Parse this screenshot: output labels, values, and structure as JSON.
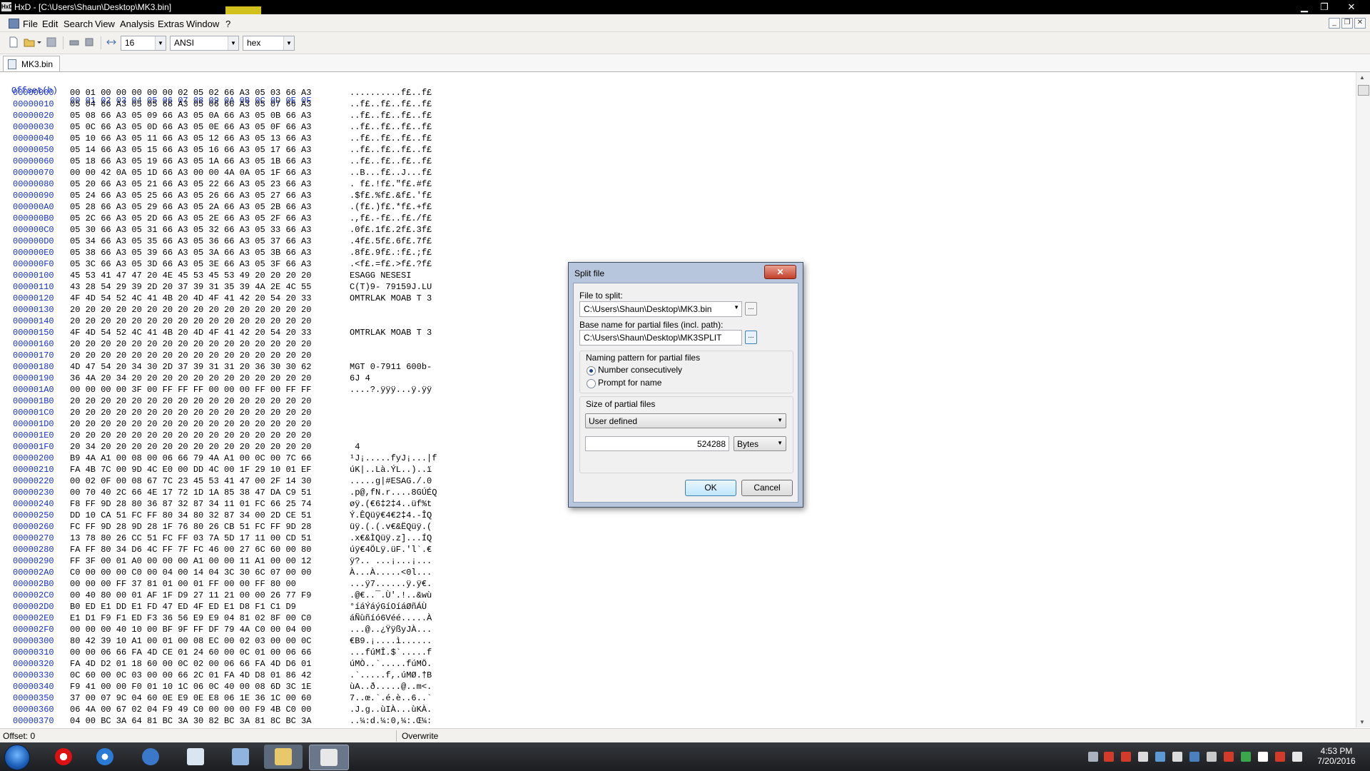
{
  "window": {
    "title": "HxD - [C:\\Users\\Shaun\\Desktop\\MK3.bin]",
    "minimize": "▁",
    "maximize": "❐",
    "close": "✕"
  },
  "menu": {
    "items": [
      "File",
      "Edit",
      "Search",
      "View",
      "Analysis",
      "Extras",
      "Window",
      "?"
    ]
  },
  "toolbar": {
    "bytes_per_row": "16",
    "charset": "ANSI",
    "offset_base": "hex"
  },
  "tab": {
    "label": "MK3.bin"
  },
  "hexview": {
    "header_offset": "Offset(h)",
    "header_columns": "00 01 02 03 04 05 06 07 08 09 0A 0B 0C 0D 0E 0F",
    "rows": [
      {
        "off": "00000000",
        "hex": "00 01 00 00 00 00 00 02 05 02 66 A3 05 03 66 A3",
        "asc": "..........f£..f£"
      },
      {
        "off": "00000010",
        "hex": "05 04 66 A3 05 05 66 A3 05 06 66 A3 05 07 66 A3",
        "asc": "..f£..f£..f£..f£"
      },
      {
        "off": "00000020",
        "hex": "05 08 66 A3 05 09 66 A3 05 0A 66 A3 05 0B 66 A3",
        "asc": "..f£..f£..f£..f£"
      },
      {
        "off": "00000030",
        "hex": "05 0C 66 A3 05 0D 66 A3 05 0E 66 A3 05 0F 66 A3",
        "asc": "..f£..f£..f£..f£"
      },
      {
        "off": "00000040",
        "hex": "05 10 66 A3 05 11 66 A3 05 12 66 A3 05 13 66 A3",
        "asc": "..f£..f£..f£..f£"
      },
      {
        "off": "00000050",
        "hex": "05 14 66 A3 05 15 66 A3 05 16 66 A3 05 17 66 A3",
        "asc": "..f£..f£..f£..f£"
      },
      {
        "off": "00000060",
        "hex": "05 18 66 A3 05 19 66 A3 05 1A 66 A3 05 1B 66 A3",
        "asc": "..f£..f£..f£..f£"
      },
      {
        "off": "00000070",
        "hex": "00 00 42 0A 05 1D 66 A3 00 00 4A 0A 05 1F 66 A3",
        "asc": "..B...f£..J...f£"
      },
      {
        "off": "00000080",
        "hex": "05 20 66 A3 05 21 66 A3 05 22 66 A3 05 23 66 A3",
        "asc": ". f£.!f£.\"f£.#f£"
      },
      {
        "off": "00000090",
        "hex": "05 24 66 A3 05 25 66 A3 05 26 66 A3 05 27 66 A3",
        "asc": ".$f£.%f£.&f£.'f£"
      },
      {
        "off": "000000A0",
        "hex": "05 28 66 A3 05 29 66 A3 05 2A 66 A3 05 2B 66 A3",
        "asc": ".(f£.)f£.*f£.+f£"
      },
      {
        "off": "000000B0",
        "hex": "05 2C 66 A3 05 2D 66 A3 05 2E 66 A3 05 2F 66 A3",
        "asc": ".,f£.-f£..f£./f£"
      },
      {
        "off": "000000C0",
        "hex": "05 30 66 A3 05 31 66 A3 05 32 66 A3 05 33 66 A3",
        "asc": ".0f£.1f£.2f£.3f£"
      },
      {
        "off": "000000D0",
        "hex": "05 34 66 A3 05 35 66 A3 05 36 66 A3 05 37 66 A3",
        "asc": ".4f£.5f£.6f£.7f£"
      },
      {
        "off": "000000E0",
        "hex": "05 38 66 A3 05 39 66 A3 05 3A 66 A3 05 3B 66 A3",
        "asc": ".8f£.9f£.:f£.;f£"
      },
      {
        "off": "000000F0",
        "hex": "05 3C 66 A3 05 3D 66 A3 05 3E 66 A3 05 3F 66 A3",
        "asc": ".<f£.=f£.>f£.?f£"
      },
      {
        "off": "00000100",
        "hex": "45 53 41 47 47 20 4E 45 53 45 53 49 20 20 20 20",
        "asc": "ESAGG NESESI    "
      },
      {
        "off": "00000110",
        "hex": "43 28 54 29 39 2D 20 37 39 31 35 39 4A 2E 4C 55",
        "asc": "C(T)9- 79159J.LU"
      },
      {
        "off": "00000120",
        "hex": "4F 4D 54 52 4C 41 4B 20 4D 4F 41 42 20 54 20 33",
        "asc": "OMTRLAK MOAB T 3"
      },
      {
        "off": "00000130",
        "hex": "20 20 20 20 20 20 20 20 20 20 20 20 20 20 20 20",
        "asc": ""
      },
      {
        "off": "00000140",
        "hex": "20 20 20 20 20 20 20 20 20 20 20 20 20 20 20 20",
        "asc": ""
      },
      {
        "off": "00000150",
        "hex": "4F 4D 54 52 4C 41 4B 20 4D 4F 41 42 20 54 20 33",
        "asc": "OMTRLAK MOAB T 3"
      },
      {
        "off": "00000160",
        "hex": "20 20 20 20 20 20 20 20 20 20 20 20 20 20 20 20",
        "asc": ""
      },
      {
        "off": "00000170",
        "hex": "20 20 20 20 20 20 20 20 20 20 20 20 20 20 20 20",
        "asc": ""
      },
      {
        "off": "00000180",
        "hex": "4D 47 54 20 34 30 2D 37 39 31 31 20 36 30 30 62",
        "asc": "MGT 0-7911 600b-"
      },
      {
        "off": "00000190",
        "hex": "36 4A 20 34 20 20 20 20 20 20 20 20 20 20 20 20",
        "asc": "6J 4"
      },
      {
        "off": "000001A0",
        "hex": "00 00 00 00 3F 00 FF FF FF 00 00 00 FF 00 FF FF",
        "asc": "....?.ÿÿÿ...ÿ.ÿÿ"
      },
      {
        "off": "000001B0",
        "hex": "20 20 20 20 20 20 20 20 20 20 20 20 20 20 20 20",
        "asc": ""
      },
      {
        "off": "000001C0",
        "hex": "20 20 20 20 20 20 20 20 20 20 20 20 20 20 20 20",
        "asc": ""
      },
      {
        "off": "000001D0",
        "hex": "20 20 20 20 20 20 20 20 20 20 20 20 20 20 20 20",
        "asc": ""
      },
      {
        "off": "000001E0",
        "hex": "20 20 20 20 20 20 20 20 20 20 20 20 20 20 20 20",
        "asc": ""
      },
      {
        "off": "000001F0",
        "hex": "20 34 20 20 20 20 20 20 20 20 20 20 20 20 20 20",
        "asc": " 4"
      },
      {
        "off": "00000200",
        "hex": "B9 4A A1 00 08 00 06 66 79 4A A1 00 0C 00 7C 66",
        "asc": "¹J¡.....fyJ¡...|f"
      },
      {
        "off": "00000210",
        "hex": "FA 4B 7C 00 9D 4C E0 00 DD 4C 00 1F 29 10 01 EF",
        "asc": "úK|..Là.ÝL..)..ï"
      },
      {
        "off": "00000220",
        "hex": "00 02 0F 00 08 67 7C 23 45 53 41 47 00 2F 14 30",
        "asc": ".....g|#ESAG./.0"
      },
      {
        "off": "00000230",
        "hex": "00 70 40 2C 66 4E 17 72 1D 1A 85 38 47 DA C9 51",
        "asc": ".p@,fN.r....8GÚÉQ"
      },
      {
        "off": "00000240",
        "hex": "F8 FF 9D 28 80 36 87 32 87 34 11 01 FC 66 25 74",
        "asc": "øÿ.(€6‡2‡4..üf%t"
      },
      {
        "off": "00000250",
        "hex": "DD 10 CA 51 FC FF 80 34 80 32 87 34 00 2D CE 51",
        "asc": "Ý.ÊQüÿ€4€2‡4.-ÎQ"
      },
      {
        "off": "00000260",
        "hex": "FC FF 9D 28 9D 28 1F 76 80 26 CB 51 FC FF 9D 28",
        "asc": "üÿ.(.(.v€&ËQüÿ.("
      },
      {
        "off": "00000270",
        "hex": "13 78 80 26 CC 51 FC FF 03 7A 5D 17 11 00 CD 51",
        "asc": ".x€&ÌQüÿ.z]...ÍQ"
      },
      {
        "off": "00000280",
        "hex": "FA FF 80 34 D6 4C FF 7F FC 46 00 27 6C 60 00 80",
        "asc": "úÿ€4ÖLÿ.üF.'l`.€"
      },
      {
        "off": "00000290",
        "hex": "FF 3F 00 01 A0 00 00 00 A1 00 00 11 A1 00 00 12",
        "asc": "ÿ?.. ...¡...¡..."
      },
      {
        "off": "000002A0",
        "hex": "C0 00 00 00 C0 00 04 00 14 04 3C 30 6C 07 00 00",
        "asc": "À...À.....<0l..."
      },
      {
        "off": "000002B0",
        "hex": "00 00 00 FF 37 81 01 00 01 FF 00 00 FF 80 00",
        "asc": "...ÿ7......ÿ.ÿ€."
      },
      {
        "off": "000002C0",
        "hex": "00 40 80 00 01 AF 1F D9 27 11 21 00 00 26 77 F9",
        "asc": ".@€..¯.Ù'.!..&wù"
      },
      {
        "off": "000002D0",
        "hex": "B0 ED E1 DD E1 FD 47 ED 4F ED E1 D8 F1 C1 D9",
        "asc": "°íáÝáýGíOíáØñÁÙ"
      },
      {
        "off": "000002E0",
        "hex": "E1 D1 F9 F1 ED F3 36 56 E9 E9 04 81 02 8F 00 C0",
        "asc": "áÑùñíó6Véé.....À"
      },
      {
        "off": "000002F0",
        "hex": "00 00 00 40 10 00 BF 9F FF DF 79 4A C0 00 04 00",
        "asc": "...@..¿ŸÿßyJÀ..."
      },
      {
        "off": "00000300",
        "hex": "80 42 39 10 A1 00 01 00 08 EC 00 02 03 00 00 0C",
        "asc": "€B9.¡....ì......"
      },
      {
        "off": "00000310",
        "hex": "00 00 06 66 FA 4D CE 01 24 60 00 0C 01 00 06 66",
        "asc": "...fúMÎ.$`.....f"
      },
      {
        "off": "00000320",
        "hex": "FA 4D D2 01 18 60 00 0C 02 00 06 66 FA 4D D6 01",
        "asc": "úMÒ..`.....fúMÖ."
      },
      {
        "off": "00000330",
        "hex": "0C 60 00 0C 03 00 00 66 2C 01 FA 4D D8 01 86 42",
        "asc": ".`.....f,.úMØ.†B"
      },
      {
        "off": "00000340",
        "hex": "F9 41 00 00 F0 01 10 1C 06 0C 40 00 08 6D 3C 1E",
        "asc": "ùA..ð.....@..m<."
      },
      {
        "off": "00000350",
        "hex": "37 00 07 9C 04 60 0E E9 0E E8 06 1E 36 1C 00 60",
        "asc": "7..œ.`.é.è..6..`"
      },
      {
        "off": "00000360",
        "hex": "06 4A 00 67 02 04 F9 49 C0 00 00 00 F9 4B C0 00",
        "asc": ".J.g..ùIÀ...ùKÀ."
      },
      {
        "off": "00000370",
        "hex": "04 00 BC 3A 64 81 BC 3A 30 82 BC 3A 81 8C BC 3A",
        "asc": "..¼:d.¼:0‚¼:.Œ¼:"
      }
    ]
  },
  "statusbar": {
    "offset": "Offset: 0",
    "mode": "Overwrite"
  },
  "dialog": {
    "title": "Split file",
    "close_label": "✕",
    "file_to_split_label": "File to split:",
    "file_to_split_value": "C:\\Users\\Shaun\\Desktop\\MK3.bin",
    "base_name_label": "Base name for partial files (incl. path):",
    "base_name_value": "C:\\Users\\Shaun\\Desktop\\MK3SPLIT",
    "browse_label": "...",
    "naming_group_label": "Naming pattern for partial files",
    "radio_consecutive": "Number consecutively",
    "radio_prompt": "Prompt for name",
    "selected_naming": "Number consecutively",
    "size_group_label": "Size of partial files",
    "size_preset": "User defined",
    "size_value": "524288",
    "size_unit": "Bytes",
    "ok_label": "OK",
    "cancel_label": "Cancel"
  },
  "taskbar": {
    "time": "4:53 PM",
    "date": "7/20/2016"
  },
  "colors": {
    "offset_blue": "#1530c8",
    "dialog_frame": "#b7c6dc",
    "close_red": "#c2402a",
    "title_accent": "#d2c11d"
  }
}
